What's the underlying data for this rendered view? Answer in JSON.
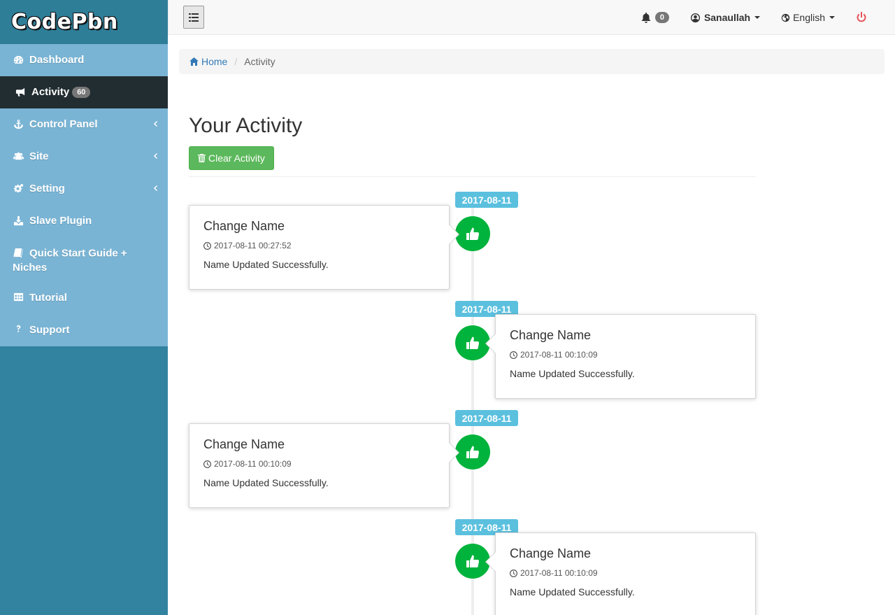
{
  "brand": {
    "name": "CodePbn"
  },
  "sidebar": {
    "items": [
      {
        "label": "Dashboard",
        "icon": "dashboard-icon"
      },
      {
        "label": "Activity",
        "icon": "bullhorn-icon",
        "badge": "60",
        "active": true
      },
      {
        "label": "Control Panel",
        "icon": "anchor-icon",
        "chevron": true
      },
      {
        "label": "Site",
        "icon": "users-icon",
        "chevron": true
      },
      {
        "label": "Setting",
        "icon": "gears-icon",
        "chevron": true
      },
      {
        "label": "Slave Plugin",
        "icon": "download-icon"
      },
      {
        "label": "Quick Start Guide + Niches",
        "icon": "book-icon"
      },
      {
        "label": "Tutorial",
        "icon": "table-icon"
      },
      {
        "label": "Support",
        "icon": "question-icon"
      }
    ]
  },
  "topbar": {
    "notifications_count": "0",
    "user_name": "Sanaullah",
    "language": "English"
  },
  "breadcrumb": {
    "home": "Home",
    "current": "Activity"
  },
  "main": {
    "title": "Your Activity",
    "clear_button": "Clear Activity"
  },
  "timeline": [
    {
      "date": "2017-08-11",
      "title": "Change Name",
      "time": "2017-08-11 00:27:52",
      "body": "Name Updated Successfully.",
      "side": "left"
    },
    {
      "date": "2017-08-11",
      "title": "Change Name",
      "time": "2017-08-11 00:10:09",
      "body": "Name Updated Successfully.",
      "side": "right"
    },
    {
      "date": "2017-08-11",
      "title": "Change Name",
      "time": "2017-08-11 00:10:09",
      "body": "Name Updated Successfully.",
      "side": "left"
    },
    {
      "date": "2017-08-11",
      "title": "Change Name",
      "time": "2017-08-11 00:10:09",
      "body": "Name Updated Successfully.",
      "side": "right"
    }
  ],
  "colors": {
    "sidebar_bg": "#3183a0",
    "menu_bg": "#7ab4d4",
    "active_bg": "#222d32",
    "date_label": "#5bc0de",
    "badge_green": "#00b33c",
    "button_green": "#5cb85c",
    "power_red": "#e8535a"
  }
}
